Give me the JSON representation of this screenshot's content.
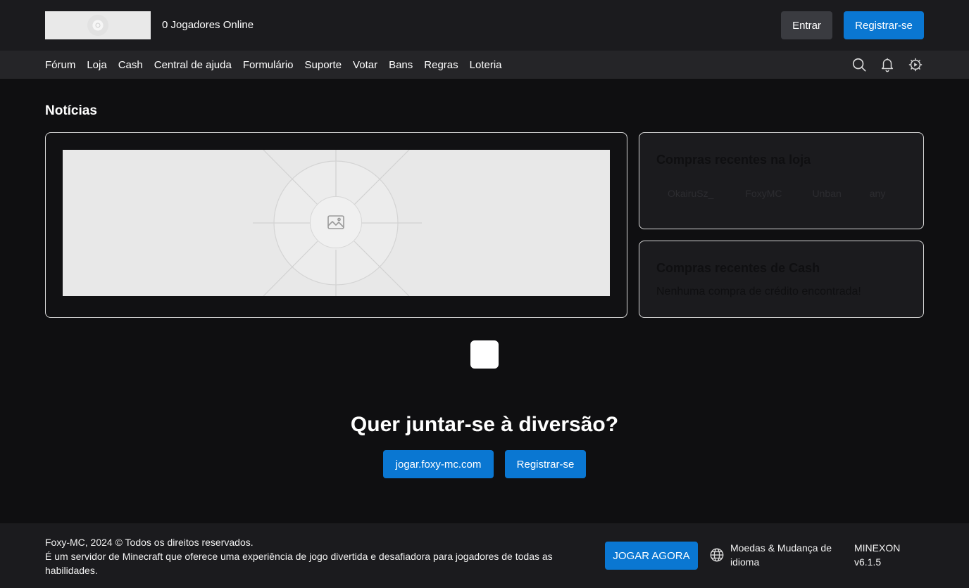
{
  "header": {
    "players_online": "0 Jogadores Online",
    "login_label": "Entrar",
    "register_label": "Registrar-se"
  },
  "nav": {
    "items": [
      {
        "label": "Fórum"
      },
      {
        "label": "Loja"
      },
      {
        "label": "Cash"
      },
      {
        "label": "Central de ajuda"
      },
      {
        "label": "Formulário"
      },
      {
        "label": "Suporte"
      },
      {
        "label": "Votar"
      },
      {
        "label": "Bans"
      },
      {
        "label": "Regras"
      },
      {
        "label": "Loteria"
      }
    ],
    "icons": [
      "search-icon",
      "bell-icon",
      "settings-icon"
    ]
  },
  "main": {
    "news_title": "Notícias",
    "shop_card": {
      "title": "Compras recentes na loja",
      "buyers": [
        "OkairuSz_",
        "FoxyMC",
        "Unban",
        "any"
      ]
    },
    "cash_card": {
      "title": "Compras recentes de Cash",
      "empty_message": "Nenhuma compra de crédito encontrada!"
    }
  },
  "cta": {
    "title": "Quer juntar-se à diversão?",
    "server_ip": "jogar.foxy-mc.com",
    "register_label": "Registrar-se"
  },
  "footer": {
    "copyright": "Foxy-MC, 2024 © Todos os direitos reservados.",
    "description": "É um servidor de Minecraft que oferece uma experiência de jogo divertida e desafiadora para jogadores de todas as habilidades.",
    "play_label": "JOGAR AGORA",
    "language_label": "Moedas & Mudança de idioma",
    "brand": "MINEXON",
    "version": "v6.1.5"
  },
  "colors": {
    "accent": "#0a77d2",
    "background": "#0f0f11",
    "bar": "#1b1b1e",
    "navbar": "#252528"
  }
}
